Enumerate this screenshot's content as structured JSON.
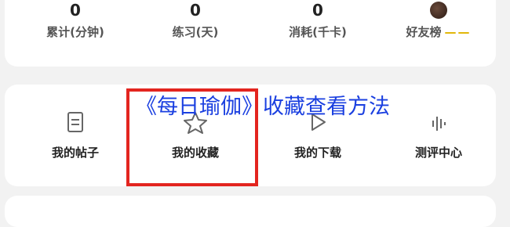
{
  "stats": [
    {
      "value": "0",
      "label": "累计(分钟)"
    },
    {
      "value": "0",
      "label": "练习(天)"
    },
    {
      "value": "0",
      "label": "消耗(千卡)"
    },
    {
      "value": "",
      "label": "好友榜",
      "extra": "——"
    }
  ],
  "menu": [
    {
      "label": "我的帖子",
      "icon": "document-icon"
    },
    {
      "label": "我的收藏",
      "icon": "star-icon"
    },
    {
      "label": "我的下载",
      "icon": "play-download-icon"
    },
    {
      "label": "测评中心",
      "icon": "soundwave-icon"
    }
  ],
  "overlay": {
    "title": "《每日瑜伽》收藏查看方法"
  },
  "colors": {
    "highlight": "#e3251f",
    "title": "#1a3fe0"
  }
}
